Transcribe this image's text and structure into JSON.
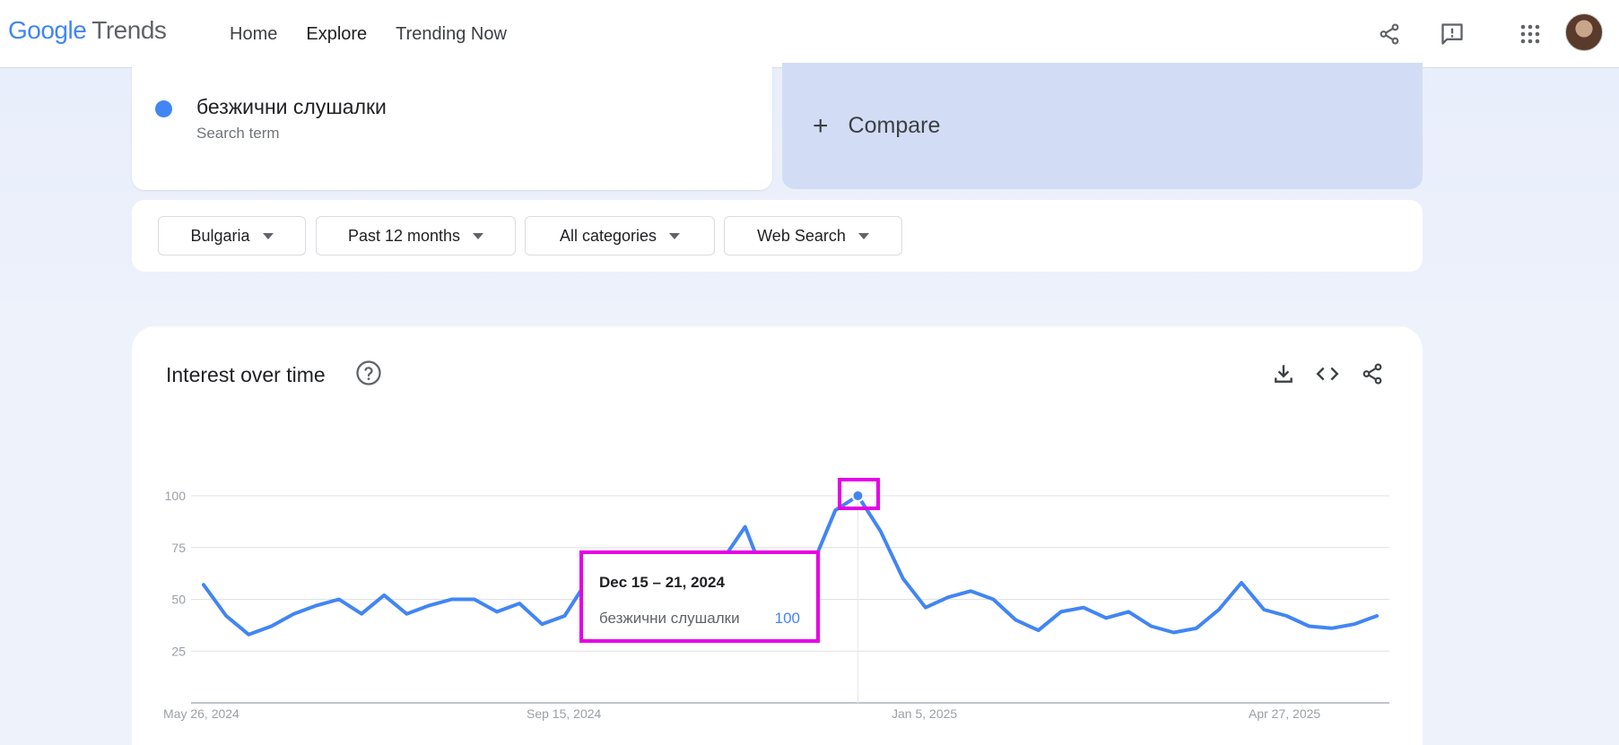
{
  "header": {
    "logo_google": "Google",
    "logo_trends": "Trends",
    "nav": [
      {
        "label": "Home"
      },
      {
        "label": "Explore"
      },
      {
        "label": "Trending Now"
      }
    ],
    "icons": [
      "share-icon",
      "feedback-icon",
      "apps-grid-icon",
      "avatar"
    ]
  },
  "search": {
    "term": "безжични слушалки",
    "term_type": "Search term",
    "term_color": "#4285f4",
    "compare_label": "Compare"
  },
  "filters": [
    {
      "label": "Bulgaria"
    },
    {
      "label": "Past 12 months"
    },
    {
      "label": "All categories"
    },
    {
      "label": "Web Search"
    }
  ],
  "chart_section": {
    "title": "Interest over time",
    "icons": [
      "help-icon",
      "download-icon",
      "embed-code-icon",
      "share-icon"
    ]
  },
  "tooltip": {
    "date": "Dec 15 – 21, 2024",
    "term": "безжични слушалки",
    "value": "100"
  },
  "chart_data": {
    "type": "line",
    "x_tick_labels": [
      "May 26, 2024",
      "Sep 15, 2024",
      "Jan 5, 2025",
      "Apr 27, 2025"
    ],
    "y_tick_labels": [
      "100",
      "75",
      "50",
      "25"
    ],
    "ylim": [
      0,
      100
    ],
    "grid": true,
    "series": [
      {
        "name": "безжични слушалки",
        "color": "#4285f4",
        "values": [
          57,
          42,
          33,
          37,
          43,
          47,
          50,
          43,
          52,
          43,
          47,
          50,
          50,
          44,
          48,
          38,
          42,
          59,
          45,
          40,
          42,
          55,
          49,
          69,
          85,
          57,
          67,
          67,
          93,
          100,
          83,
          60,
          46,
          51,
          54,
          50,
          40,
          35,
          44,
          46,
          41,
          44,
          37,
          34,
          36,
          45,
          58,
          45,
          42,
          37,
          36,
          38,
          42
        ]
      }
    ],
    "highlight_index": 29
  }
}
